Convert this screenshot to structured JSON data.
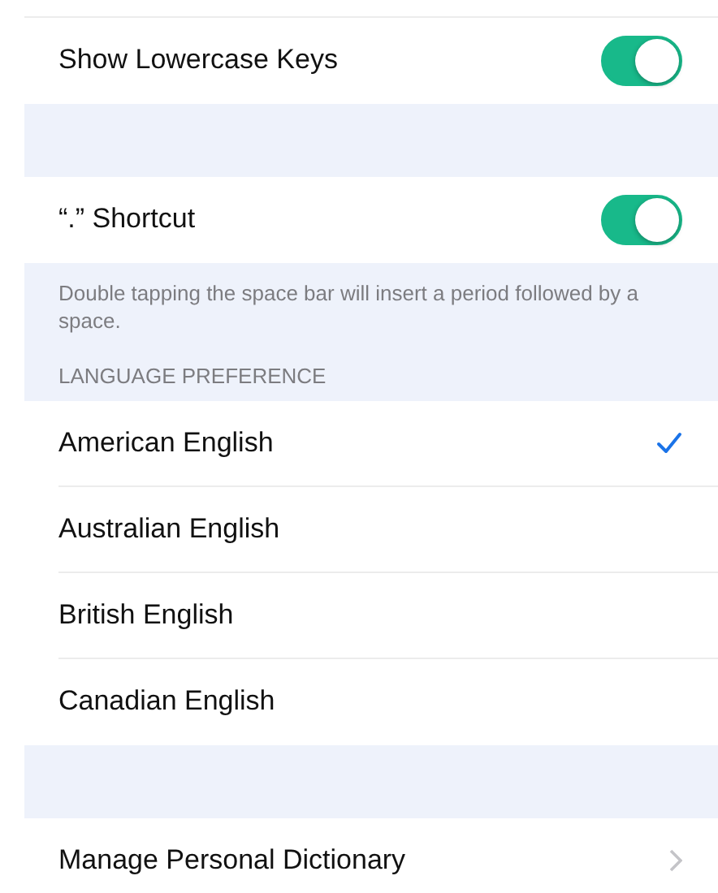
{
  "sections": [
    {
      "rows": [
        {
          "kind": "toggle",
          "label": "Show Lowercase Keys",
          "on": true
        }
      ]
    },
    {
      "rows": [
        {
          "kind": "toggle",
          "label": "“.” Shortcut",
          "on": true
        }
      ],
      "footer": "Double tapping the space bar will insert a period followed by a space."
    },
    {
      "header": "LANGUAGE PREFERENCE",
      "rows": [
        {
          "kind": "choice",
          "label": "American English",
          "selected": true
        },
        {
          "kind": "choice",
          "label": "Australian English",
          "selected": false
        },
        {
          "kind": "choice",
          "label": "British English",
          "selected": false
        },
        {
          "kind": "choice",
          "label": "Canadian English",
          "selected": false
        }
      ]
    },
    {
      "rows": [
        {
          "kind": "link",
          "label": "Manage Personal Dictionary"
        }
      ]
    }
  ]
}
